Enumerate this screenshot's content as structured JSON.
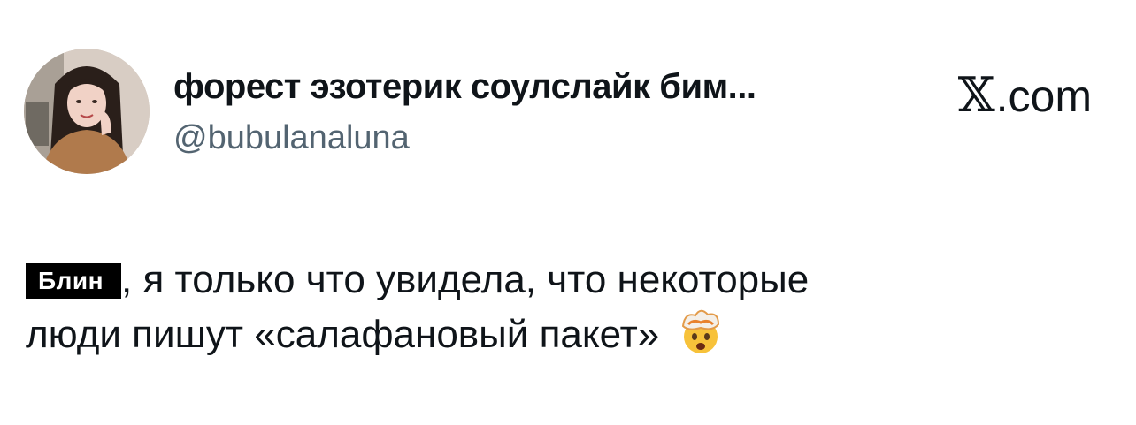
{
  "author": {
    "display_name": "форест эзотерик соулслайк бим...",
    "handle": "@bubulanaluna"
  },
  "brand": {
    "glyph": "𝕏",
    "suffix": ".com"
  },
  "tweet": {
    "censored_word": "Блин",
    "text_line1": ", я только что увидела, что некоторые",
    "text_line2": "люди пишут «салафановый пакет»",
    "emoji": "exploding-head-icon"
  }
}
